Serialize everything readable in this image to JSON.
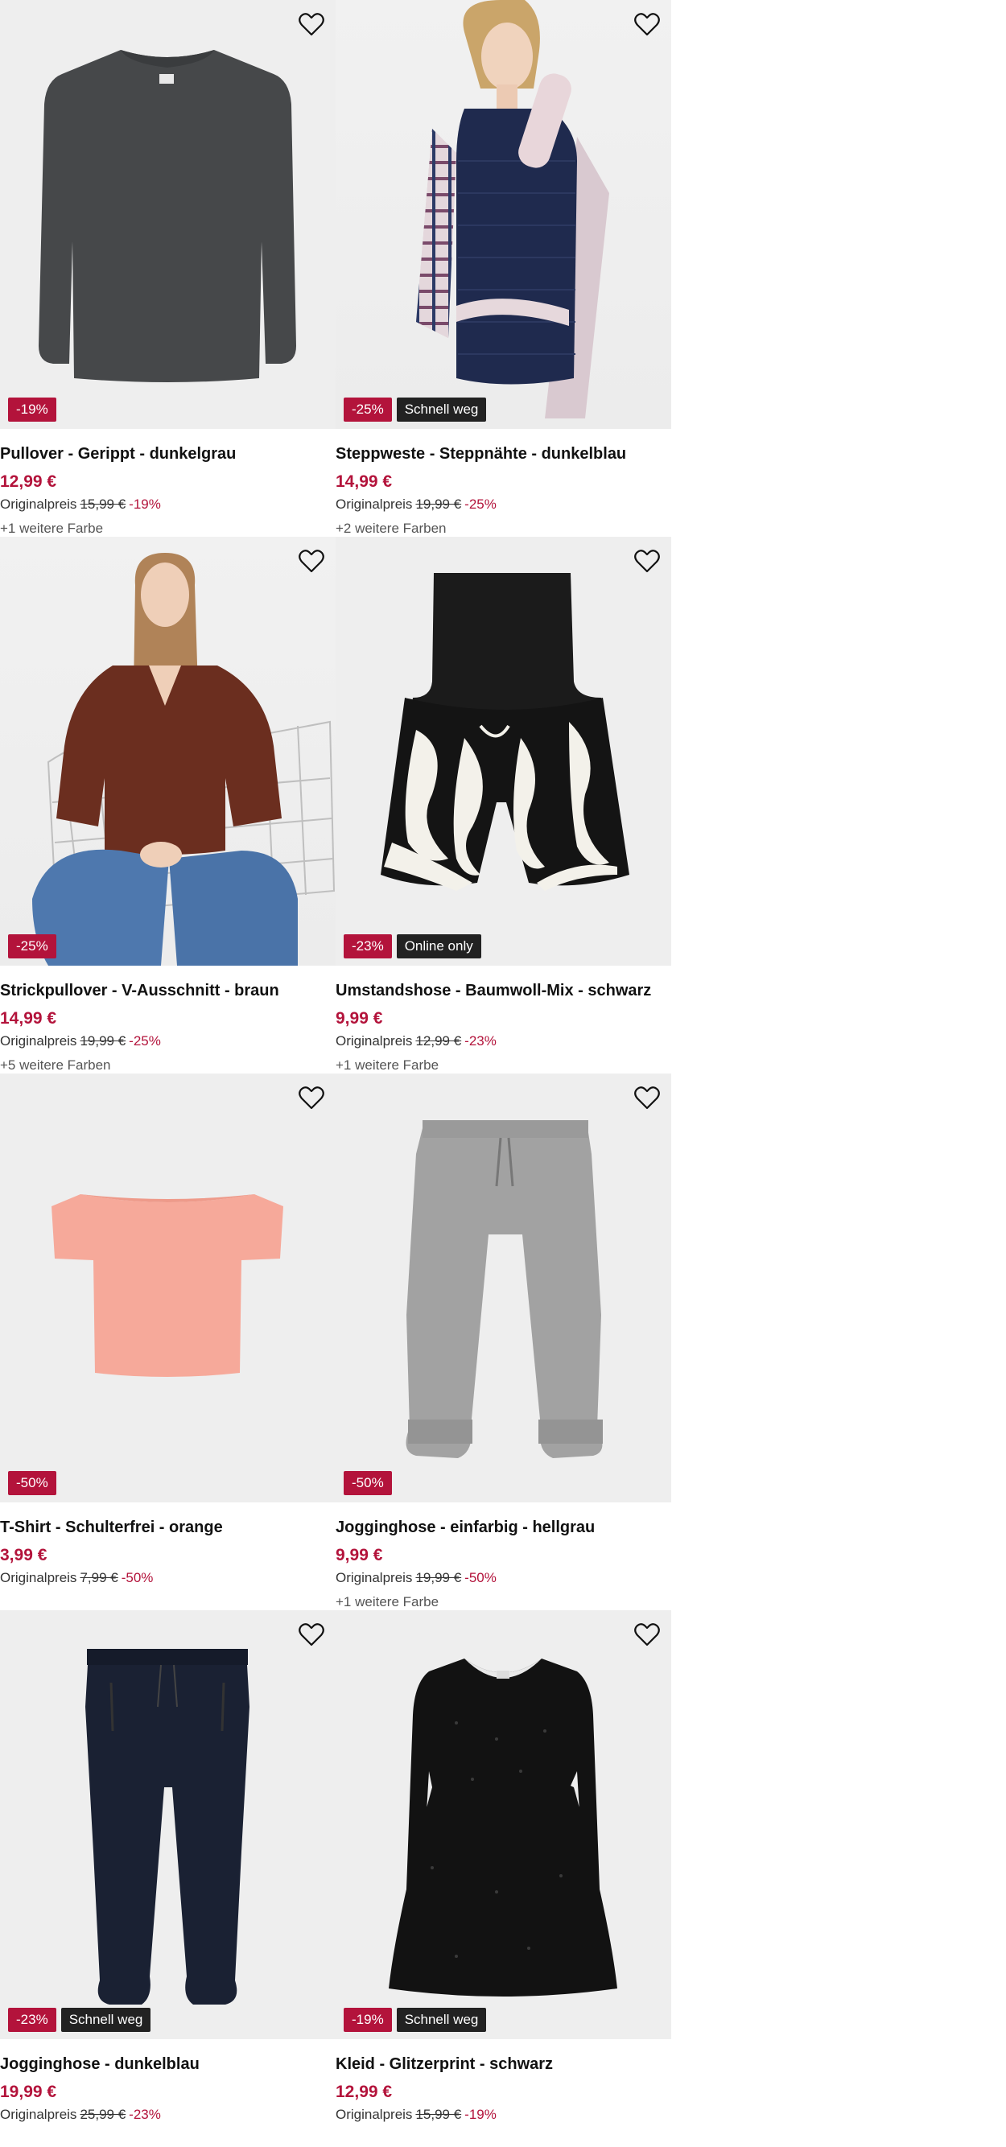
{
  "products": [
    {
      "title": "Pullover - Gerippt - dunkelgrau",
      "price": "12,99 €",
      "orig_label": "Originalpreis",
      "orig_price": "15,99 €",
      "orig_discount": "-19%",
      "more_colors": "+1 weitere Farbe",
      "badge_discount": "-19%",
      "badge_info": "",
      "image": "sweater-dark-grey"
    },
    {
      "title": "Steppweste - Steppnähte - dunkelblau",
      "price": "14,99 €",
      "orig_label": "Originalpreis",
      "orig_price": "19,99 €",
      "orig_discount": "-25%",
      "more_colors": "+2 weitere Farben",
      "badge_discount": "-25%",
      "badge_info": "Schnell weg",
      "image": "model-navy-vest"
    },
    {
      "title": "Strickpullover - V-Ausschnitt - braun",
      "price": "14,99 €",
      "orig_label": "Originalpreis",
      "orig_price": "19,99 €",
      "orig_discount": "-25%",
      "more_colors": "+5 weitere Farben",
      "badge_discount": "-25%",
      "badge_info": "",
      "image": "model-brown-sweater"
    },
    {
      "title": "Umstandshose - Baumwoll-Mix - schwarz",
      "price": "9,99 €",
      "orig_label": "Originalpreis",
      "orig_price": "12,99 €",
      "orig_discount": "-23%",
      "more_colors": "+1 weitere Farbe",
      "badge_discount": "-23%",
      "badge_info": "Online only",
      "image": "maternity-shorts"
    },
    {
      "title": "T-Shirt - Schulterfrei - orange",
      "price": "3,99 €",
      "orig_label": "Originalpreis",
      "orig_price": "7,99 €",
      "orig_discount": "-50%",
      "more_colors": "",
      "badge_discount": "-50%",
      "badge_info": "",
      "image": "tshirt-orange"
    },
    {
      "title": "Jogginghose - einfarbig - hellgrau",
      "price": "9,99 €",
      "orig_label": "Originalpreis",
      "orig_price": "19,99 €",
      "orig_discount": "-50%",
      "more_colors": "+1 weitere Farbe",
      "badge_discount": "-50%",
      "badge_info": "",
      "image": "joggers-light-grey"
    },
    {
      "title": "Jogginghose - dunkelblau",
      "price": "19,99 €",
      "orig_label": "Originalpreis",
      "orig_price": "25,99 €",
      "orig_discount": "-23%",
      "more_colors": "",
      "badge_discount": "-23%",
      "badge_info": "Schnell weg",
      "image": "joggers-navy"
    },
    {
      "title": "Kleid - Glitzerprint - schwarz",
      "price": "12,99 €",
      "orig_label": "Originalpreis",
      "orig_price": "15,99 €",
      "orig_discount": "-19%",
      "more_colors": "",
      "badge_discount": "-19%",
      "badge_info": "Schnell weg",
      "image": "dress-black-glitter"
    }
  ],
  "icons": {
    "favorite": "heart-outline-icon"
  },
  "colors": {
    "sale": "#b3133b",
    "badge_dark": "#222222"
  }
}
